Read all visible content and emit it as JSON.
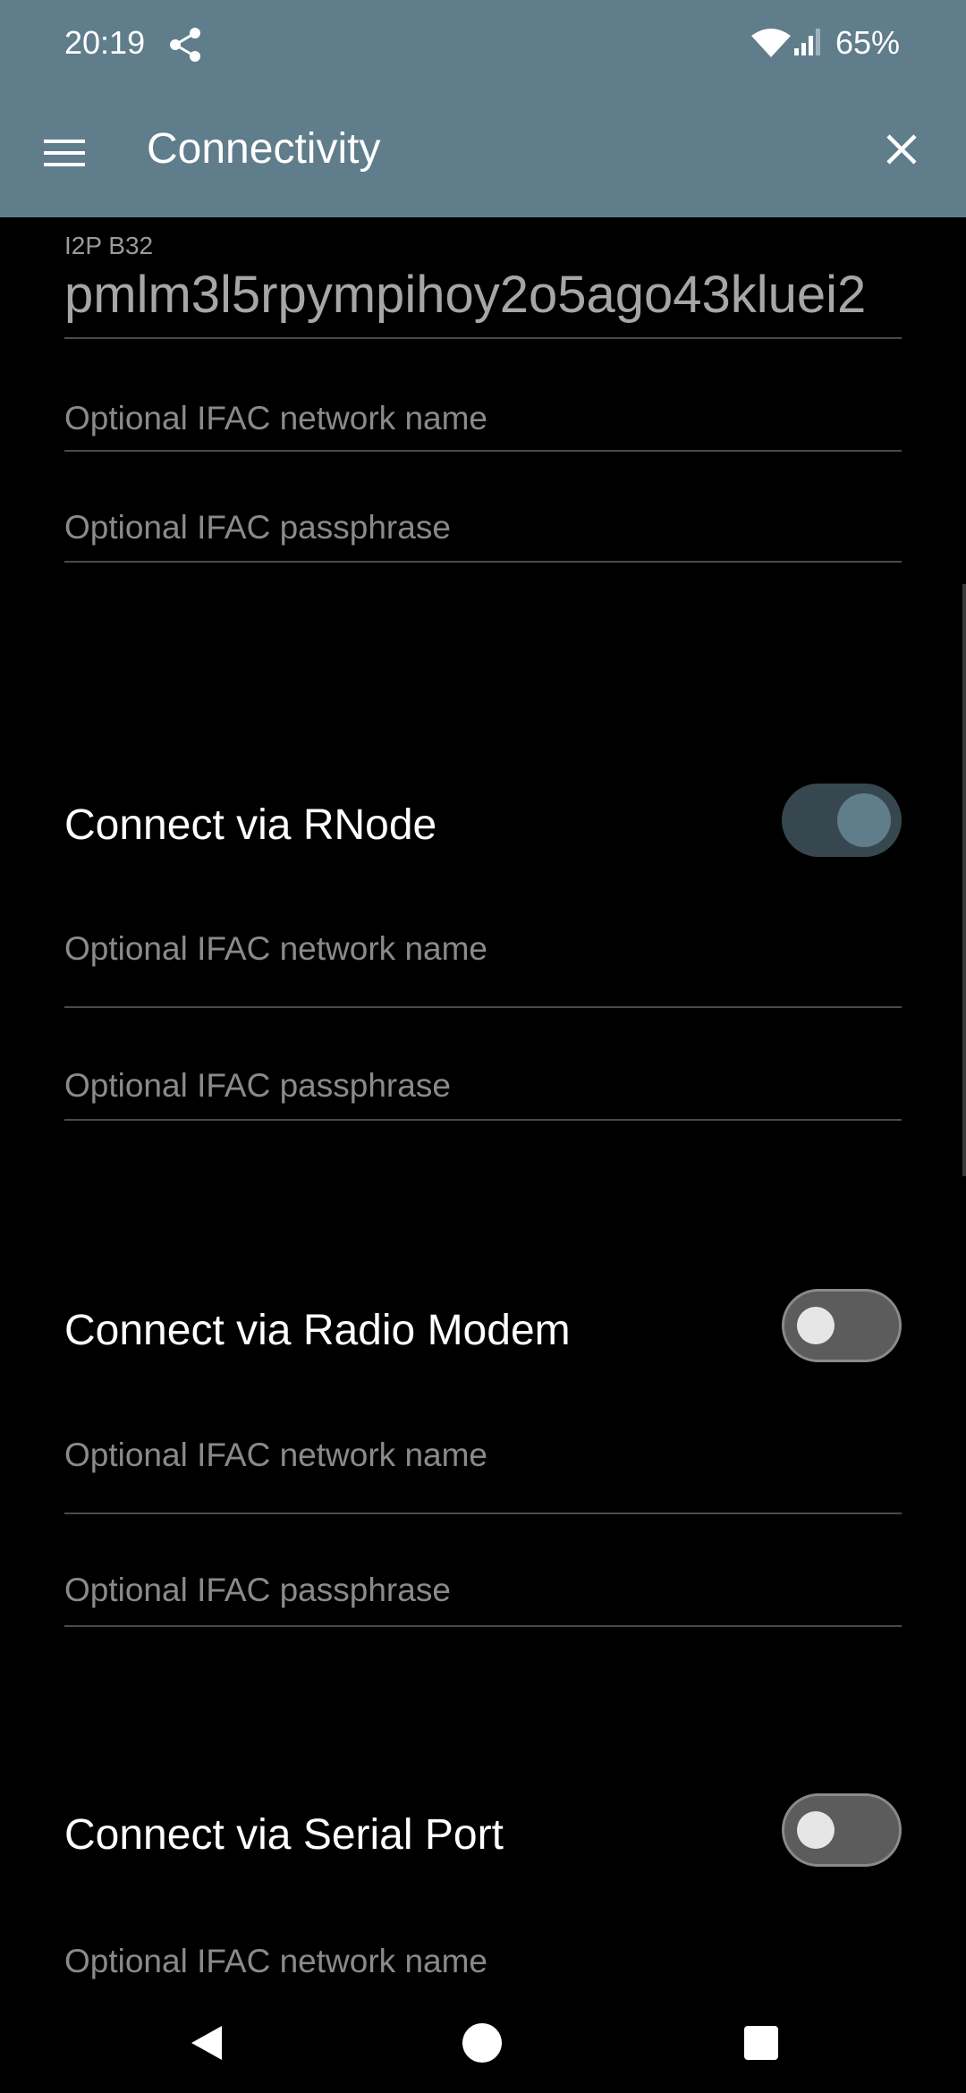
{
  "status_bar": {
    "time": "20:19",
    "battery": "65%",
    "icons": [
      "share-icon",
      "wifi-icon",
      "cell-signal-icon"
    ]
  },
  "app_bar": {
    "title": "Connectivity",
    "menu_icon": "hamburger-menu-icon",
    "close_icon": "close-icon",
    "background": "#607d8b"
  },
  "i2p": {
    "label": "I2P B32",
    "value": "pmlm3l5rpympihoy2o5ago43kluei2"
  },
  "i2p_ifac": {
    "network_name_placeholder": "Optional IFAC network name",
    "passphrase_placeholder": "Optional IFAC passphrase"
  },
  "rnode": {
    "title": "Connect via RNode",
    "enabled": true,
    "network_name_placeholder": "Optional IFAC network name",
    "passphrase_placeholder": "Optional IFAC passphrase"
  },
  "radio_modem": {
    "title": "Connect via Radio Modem",
    "enabled": false,
    "network_name_placeholder": "Optional IFAC network name",
    "passphrase_placeholder": "Optional IFAC passphrase"
  },
  "serial_port": {
    "title": "Connect via Serial Port",
    "enabled": false,
    "network_name_placeholder": "Optional IFAC network name"
  },
  "nav_bar": {
    "icons": [
      "back-icon",
      "home-icon",
      "recents-icon"
    ]
  }
}
